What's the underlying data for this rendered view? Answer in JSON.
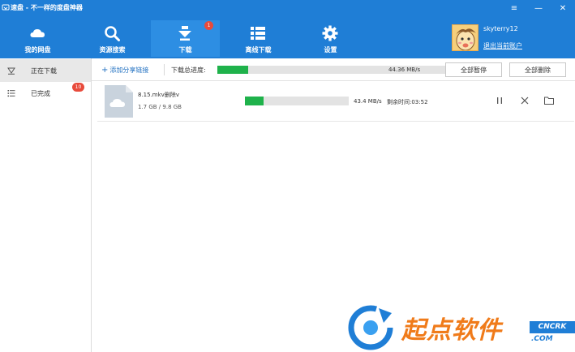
{
  "window": {
    "title": "速盘 - 不一样的度盘神器",
    "menu_glyph": "≡",
    "minimize_glyph": "—",
    "close_glyph": "✕"
  },
  "nav": {
    "items": [
      {
        "label": "我的网盘",
        "icon": "cloud-icon"
      },
      {
        "label": "资源搜索",
        "icon": "search-icon"
      },
      {
        "label": "下载",
        "icon": "download-icon",
        "badge": "1",
        "active": true
      },
      {
        "label": "离线下载",
        "icon": "list-grid-icon"
      },
      {
        "label": "设置",
        "icon": "gear-icon"
      }
    ]
  },
  "user": {
    "name": "skyterry12",
    "logout_label": "退出当前账户"
  },
  "sidebar": {
    "items": [
      {
        "label": "正在下载",
        "icon": "downloading-icon",
        "active": true
      },
      {
        "label": "已完成",
        "icon": "list-icon",
        "badge": "10"
      }
    ]
  },
  "toolbar": {
    "add_label": "添加分享链接",
    "total_label": "下载总进度:",
    "total_progress": 0.12,
    "total_speed": "44.36 MB/s",
    "pause_all_label": "全部暂停",
    "delete_all_label": "全部删除"
  },
  "tasks": [
    {
      "name": "8.15.mkv删除v",
      "size": "1.7 GB / 9.8 GB",
      "progress": 0.18,
      "speed": "43.4 MB/s",
      "remaining": "剩余时间:03:52"
    }
  ],
  "watermark": {
    "text": "起点软件",
    "tag": "CNCRK",
    "domain": ".COM"
  },
  "colors": {
    "header": "#1f7ed6",
    "progress": "#1fb24b",
    "badge": "#e84b3c"
  }
}
